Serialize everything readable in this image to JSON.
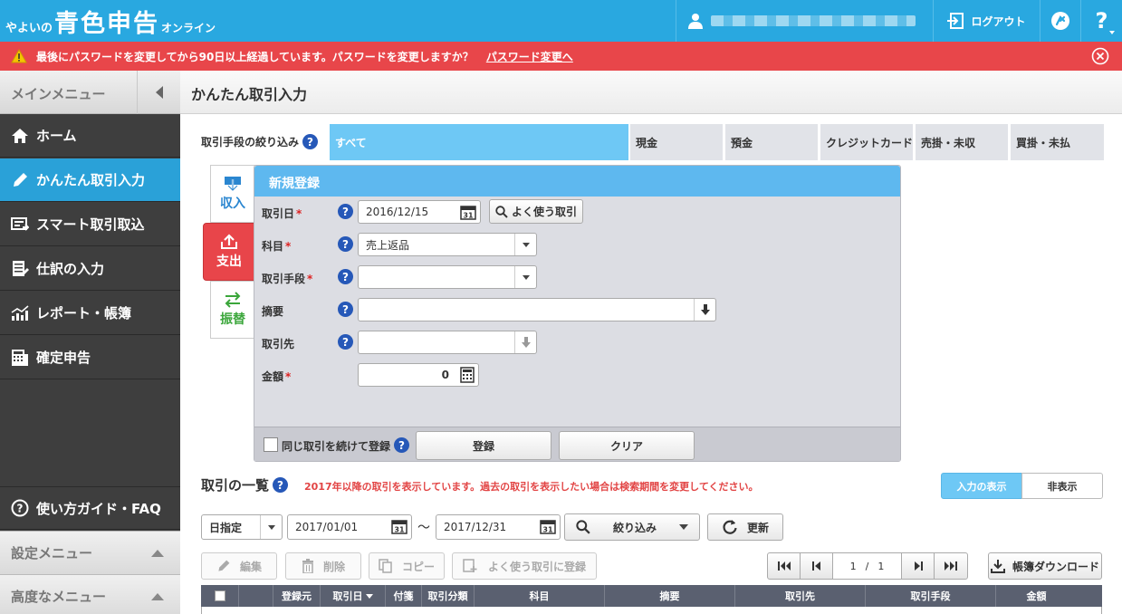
{
  "header": {
    "logo_pre": "やよいの",
    "logo_main": "青色申告",
    "logo_post": "オンライン",
    "logout_label": "ログアウト"
  },
  "alert": {
    "message": "最後にパスワードを変更してから90日以上経過しています。パスワードを変更しますか？",
    "link": "パスワード変更へ"
  },
  "sidebar": {
    "title": "メインメニュー",
    "items": [
      {
        "label": "ホーム"
      },
      {
        "label": "かんたん取引入力"
      },
      {
        "label": "スマート取引取込"
      },
      {
        "label": "仕訳の入力"
      },
      {
        "label": "レポート・帳簿"
      },
      {
        "label": "確定申告"
      }
    ],
    "guide": "使い方ガイド・FAQ",
    "settings": "設定メニュー",
    "advanced": "高度なメニュー"
  },
  "page": {
    "title": "かんたん取引入力"
  },
  "filter": {
    "label": "取引手段の絞り込み",
    "tabs": [
      "すべて",
      "現金",
      "預金",
      "クレジットカード",
      "売掛・未収",
      "買掛・未払"
    ]
  },
  "types": {
    "income": "収入",
    "expense": "支出",
    "transfer": "振替"
  },
  "form": {
    "title": "新規登録",
    "date_label": "取引日",
    "date_value": "2016/12/15",
    "favorite_button": "よく使う取引",
    "account_label": "科目",
    "account_value": "売上返品",
    "method_label": "取引手段",
    "summary_label": "摘要",
    "partner_label": "取引先",
    "amount_label": "金額",
    "amount_value": "0",
    "repeat_label": "同じ取引を続けて登録",
    "register_button": "登録",
    "clear_button": "クリア"
  },
  "list": {
    "title": "取引の一覧",
    "notice": "2017年以降の取引を表示しています。過去の取引を表示したい場合は検索期間を変更してください。",
    "show_input": "入力の表示",
    "hide": "非表示",
    "range_type": "日指定",
    "from_date": "2017/01/01",
    "tilde": "〜",
    "to_date": "2017/12/31",
    "filter_button": "絞り込み",
    "refresh_button": "更新",
    "edit_button": "編集",
    "delete_button": "削除",
    "copy_button": "コピー",
    "favorite_register_button": "よく使う取引に登録",
    "page_current": "1",
    "page_sep": "/",
    "page_total": "1",
    "download_button": "帳簿ダウンロード",
    "columns": [
      "登録元",
      "取引日",
      "付箋",
      "取引分類",
      "科目",
      "摘要",
      "取引先",
      "取引手段",
      "金額"
    ]
  }
}
